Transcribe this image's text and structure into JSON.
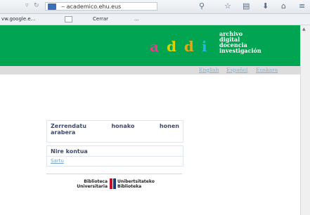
{
  "browser": {
    "url": "academico.ehu.eus",
    "url_prefix": "‒",
    "bookmarks": [
      "vw.google.e...",
      "Cerrar",
      "..."
    ]
  },
  "header": {
    "logo": [
      "a",
      "d",
      "d",
      "i"
    ],
    "subtitle_lines": [
      "archivo",
      "digital",
      "docencia",
      "investigación"
    ],
    "colors": {
      "background": "#00a451",
      "a": "#e33e87",
      "d1": "#d7d400",
      "d2": "#f0a30c",
      "i": "#2ab3e6"
    }
  },
  "languages": [
    "English",
    "Español",
    "Euskara"
  ],
  "browse_panel": {
    "title_words": [
      "Zerrendatu",
      "honako",
      "honen"
    ],
    "title_line2": "arabera"
  },
  "account_panel": {
    "title": "Nire kontua",
    "login_link": "Sartu"
  },
  "footer_logo": {
    "left_lines": [
      "Biblioteca",
      "Universitaria"
    ],
    "right_lines": [
      "Unibertsitateko",
      "Biblioteka"
    ]
  }
}
